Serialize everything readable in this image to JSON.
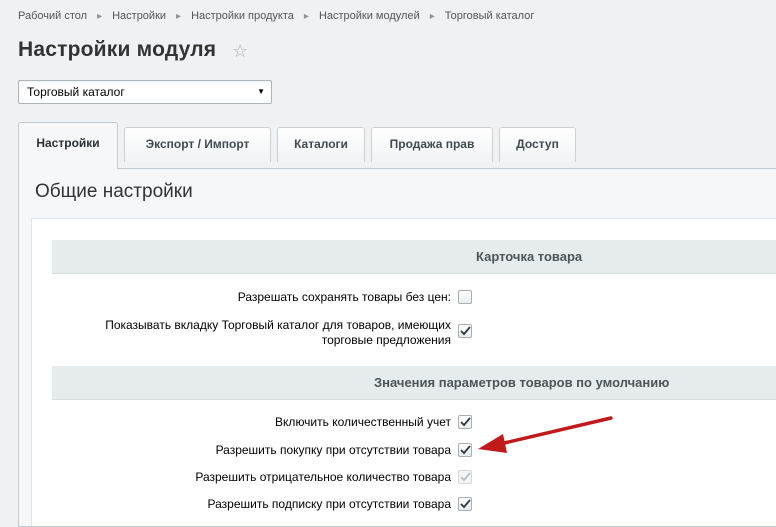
{
  "breadcrumbs": [
    "Рабочий стол",
    "Настройки",
    "Настройки продукта",
    "Настройки модулей",
    "Торговый каталог"
  ],
  "page_title": "Настройки модуля",
  "module_select": {
    "value": "Торговый каталог"
  },
  "tabs": [
    {
      "label": "Настройки",
      "active": true
    },
    {
      "label": "Экспорт / Импорт"
    },
    {
      "label": "Каталоги"
    },
    {
      "label": "Продажа прав"
    },
    {
      "label": "Доступ"
    }
  ],
  "section_title": "Общие настройки",
  "groups": [
    {
      "title": "Карточка товара",
      "rows": [
        {
          "label": "Разрешать сохранять товары без цен:",
          "checked": false
        },
        {
          "label_line1": "Показывать вкладку Торговый каталог для товаров, имеющих",
          "label_line2": "торговые предложения",
          "checked": true
        }
      ]
    },
    {
      "title": "Значения параметров товаров по умолчанию",
      "rows": [
        {
          "label": "Включить количественный учет",
          "checked": true
        },
        {
          "label": "Разрешить покупку при отсутствии товара",
          "checked": true,
          "highlighted_by_arrow": true
        },
        {
          "label": "Разрешить отрицательное количество товара",
          "checked": true,
          "disabled": true
        },
        {
          "label": "Разрешить подписку при отсутствии товара",
          "checked": true
        }
      ]
    }
  ],
  "colors": {
    "annotation_arrow": "#c21a1a",
    "check": "#2f3a40",
    "check_disabled": "#b9c0c4"
  },
  "icons": {
    "favorite": "star-outline-icon",
    "dropdown": "triangle-down-icon",
    "check": "checkmark-icon"
  }
}
